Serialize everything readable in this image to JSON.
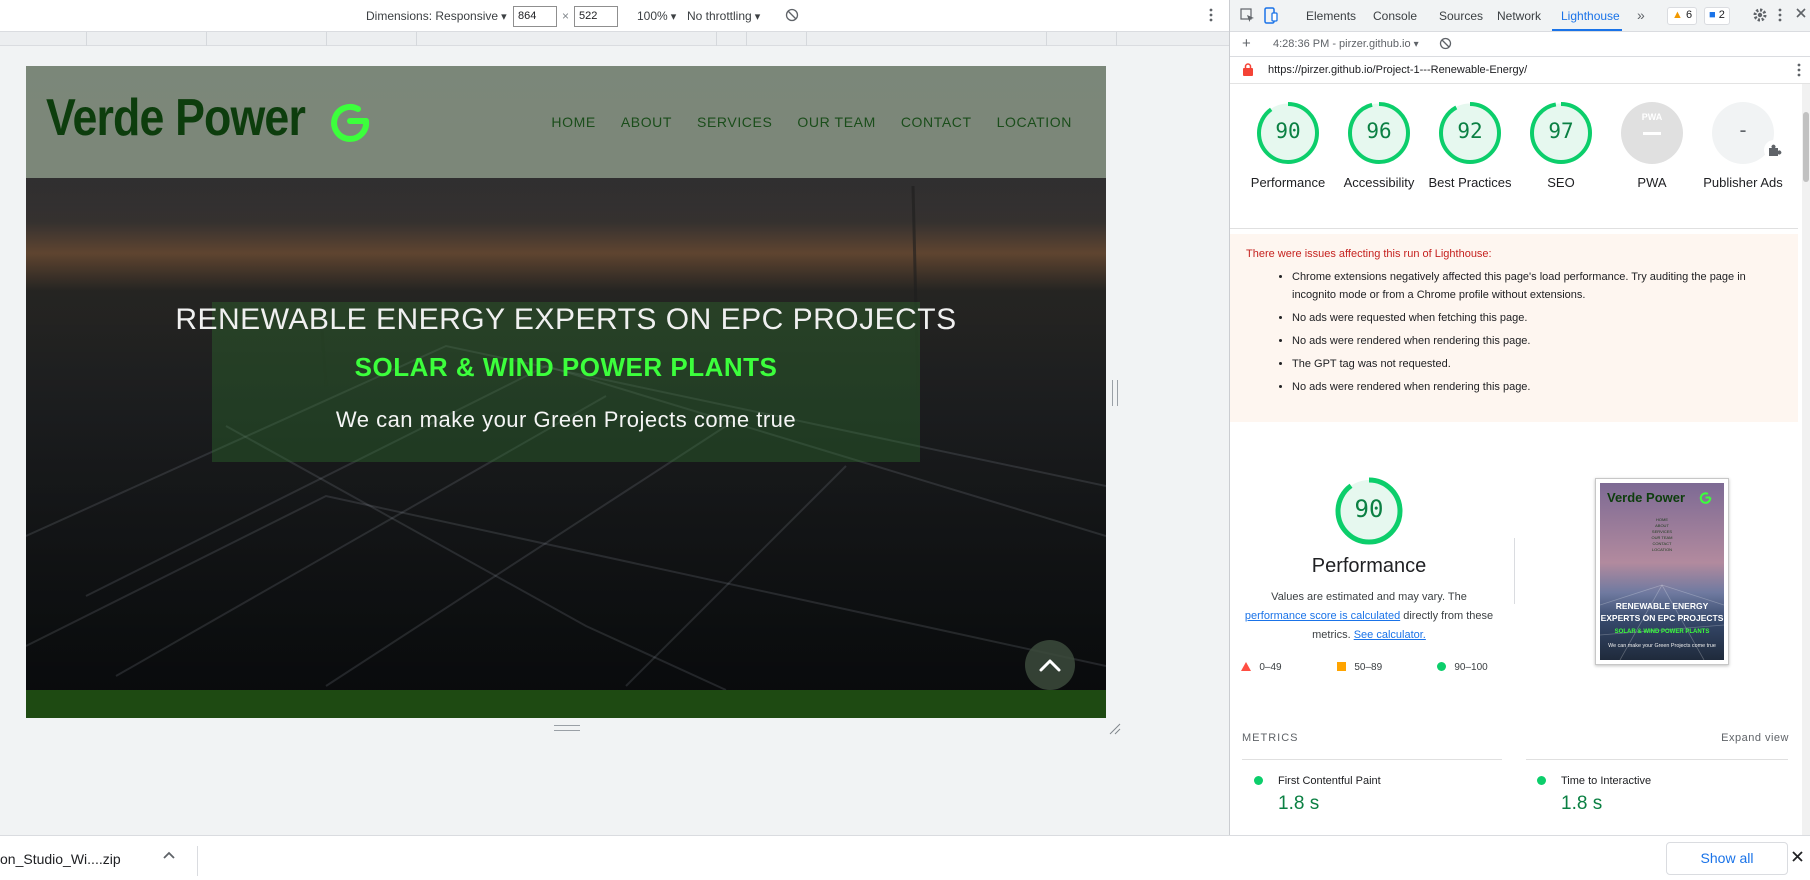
{
  "device_toolbar": {
    "dimensions_label": "Dimensions: Responsive",
    "width": "864",
    "times": "×",
    "height": "522",
    "zoom": "100%",
    "throttling": "No throttling"
  },
  "site": {
    "brand": "Verde Power",
    "menu": [
      "HOME",
      "ABOUT",
      "SERVICES",
      "OUR TEAM",
      "CONTACT",
      "LOCATION"
    ],
    "hero_title": "RENEWABLE ENERGY EXPERTS ON EPC PROJECTS",
    "hero_subtitle": "SOLAR & WIND POWER PLANTS",
    "hero_tagline": "We can make your Green Projects come true"
  },
  "devtools": {
    "tabs": [
      "Elements",
      "Console",
      "Sources",
      "Network",
      "Lighthouse"
    ],
    "active_tab": "Lighthouse",
    "more_tabs": "»",
    "warnings_count": "6",
    "messages_count": "2",
    "report_time": "4:28:36 PM - pirzer.github.io",
    "url": "https://pirzer.github.io/Project-1---Renewable-Energy/",
    "scores": [
      {
        "label": "Performance",
        "value": "90",
        "fraction": 0.9
      },
      {
        "label": "Accessibility",
        "value": "96",
        "fraction": 0.96
      },
      {
        "label": "Best Practices",
        "value": "92",
        "fraction": 0.92
      },
      {
        "label": "SEO",
        "value": "97",
        "fraction": 0.97
      },
      {
        "label": "PWA",
        "value": "PWA"
      },
      {
        "label": "Publisher Ads",
        "value": "-"
      }
    ],
    "warnings": {
      "title": "There were issues affecting this run of Lighthouse:",
      "items": [
        "Chrome extensions negatively affected this page's load performance. Try auditing the page in incognito mode or from a Chrome profile without extensions.",
        "No ads were requested when fetching this page.",
        "No ads were rendered when rendering this page.",
        "The GPT tag was not requested.",
        "No ads were rendered when rendering this page."
      ]
    },
    "performance": {
      "score": "90",
      "fraction": 0.9,
      "title": "Performance",
      "desc_1": "Values are estimated and may vary. The ",
      "link_1": "performance score is calculated",
      "desc_2": " directly from these metrics. ",
      "link_2": "See calculator.",
      "legend": [
        "0–49",
        "50–89",
        "90–100"
      ]
    },
    "thumbnail": {
      "brand": "Verde Power",
      "menu": [
        "HOME",
        "ABOUT",
        "SERVICES",
        "OUR TEAM",
        "CONTACT",
        "LOCATION"
      ],
      "title": "RENEWABLE ENERGY EXPERTS ON EPC PROJECTS",
      "subtitle": "SOLAR & WIND POWER PLANTS",
      "tagline": "We can make your Green Projects come true"
    },
    "metrics": {
      "heading": "METRICS",
      "expand": "Expand view",
      "items": [
        {
          "name": "First Contentful Paint",
          "value": "1.8 s"
        },
        {
          "name": "Time to Interactive",
          "value": "1.8 s"
        }
      ]
    }
  },
  "download_bar": {
    "file": "on_Studio_Wi....zip",
    "show_all": "Show all"
  },
  "colors": {
    "pass_green": "#0cce6b",
    "score_text": "#0b8043",
    "fail_red": "#ff4e42",
    "average_orange": "#ffa400",
    "accent_blue": "#1a73e8"
  }
}
